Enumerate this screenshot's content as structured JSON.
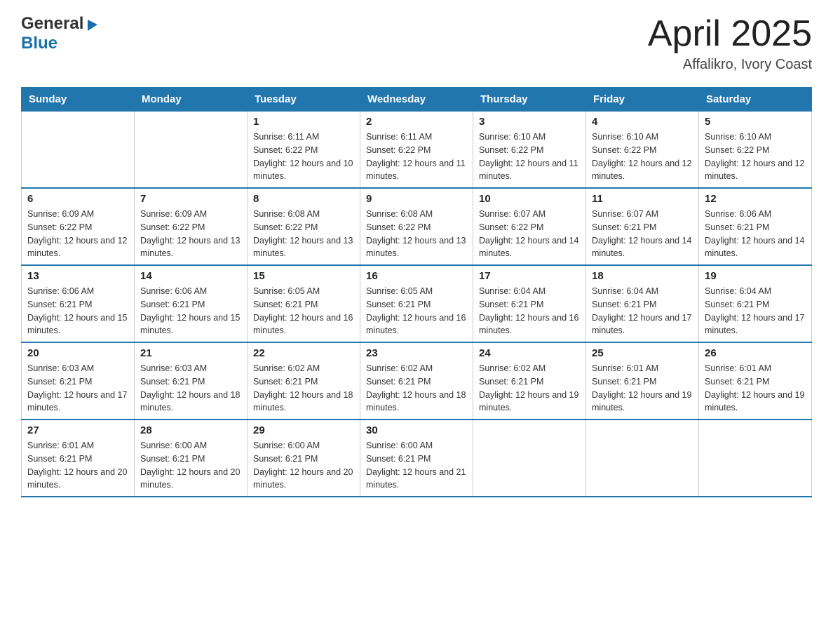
{
  "header": {
    "logo": {
      "general": "General",
      "blue": "Blue",
      "triangle": "▶"
    },
    "title": "April 2025",
    "location": "Affalikro, Ivory Coast"
  },
  "calendar": {
    "days_of_week": [
      "Sunday",
      "Monday",
      "Tuesday",
      "Wednesday",
      "Thursday",
      "Friday",
      "Saturday"
    ],
    "weeks": [
      [
        {
          "day": "",
          "sunrise": "",
          "sunset": "",
          "daylight": ""
        },
        {
          "day": "",
          "sunrise": "",
          "sunset": "",
          "daylight": ""
        },
        {
          "day": "1",
          "sunrise": "Sunrise: 6:11 AM",
          "sunset": "Sunset: 6:22 PM",
          "daylight": "Daylight: 12 hours and 10 minutes."
        },
        {
          "day": "2",
          "sunrise": "Sunrise: 6:11 AM",
          "sunset": "Sunset: 6:22 PM",
          "daylight": "Daylight: 12 hours and 11 minutes."
        },
        {
          "day": "3",
          "sunrise": "Sunrise: 6:10 AM",
          "sunset": "Sunset: 6:22 PM",
          "daylight": "Daylight: 12 hours and 11 minutes."
        },
        {
          "day": "4",
          "sunrise": "Sunrise: 6:10 AM",
          "sunset": "Sunset: 6:22 PM",
          "daylight": "Daylight: 12 hours and 12 minutes."
        },
        {
          "day": "5",
          "sunrise": "Sunrise: 6:10 AM",
          "sunset": "Sunset: 6:22 PM",
          "daylight": "Daylight: 12 hours and 12 minutes."
        }
      ],
      [
        {
          "day": "6",
          "sunrise": "Sunrise: 6:09 AM",
          "sunset": "Sunset: 6:22 PM",
          "daylight": "Daylight: 12 hours and 12 minutes."
        },
        {
          "day": "7",
          "sunrise": "Sunrise: 6:09 AM",
          "sunset": "Sunset: 6:22 PM",
          "daylight": "Daylight: 12 hours and 13 minutes."
        },
        {
          "day": "8",
          "sunrise": "Sunrise: 6:08 AM",
          "sunset": "Sunset: 6:22 PM",
          "daylight": "Daylight: 12 hours and 13 minutes."
        },
        {
          "day": "9",
          "sunrise": "Sunrise: 6:08 AM",
          "sunset": "Sunset: 6:22 PM",
          "daylight": "Daylight: 12 hours and 13 minutes."
        },
        {
          "day": "10",
          "sunrise": "Sunrise: 6:07 AM",
          "sunset": "Sunset: 6:22 PM",
          "daylight": "Daylight: 12 hours and 14 minutes."
        },
        {
          "day": "11",
          "sunrise": "Sunrise: 6:07 AM",
          "sunset": "Sunset: 6:21 PM",
          "daylight": "Daylight: 12 hours and 14 minutes."
        },
        {
          "day": "12",
          "sunrise": "Sunrise: 6:06 AM",
          "sunset": "Sunset: 6:21 PM",
          "daylight": "Daylight: 12 hours and 14 minutes."
        }
      ],
      [
        {
          "day": "13",
          "sunrise": "Sunrise: 6:06 AM",
          "sunset": "Sunset: 6:21 PM",
          "daylight": "Daylight: 12 hours and 15 minutes."
        },
        {
          "day": "14",
          "sunrise": "Sunrise: 6:06 AM",
          "sunset": "Sunset: 6:21 PM",
          "daylight": "Daylight: 12 hours and 15 minutes."
        },
        {
          "day": "15",
          "sunrise": "Sunrise: 6:05 AM",
          "sunset": "Sunset: 6:21 PM",
          "daylight": "Daylight: 12 hours and 16 minutes."
        },
        {
          "day": "16",
          "sunrise": "Sunrise: 6:05 AM",
          "sunset": "Sunset: 6:21 PM",
          "daylight": "Daylight: 12 hours and 16 minutes."
        },
        {
          "day": "17",
          "sunrise": "Sunrise: 6:04 AM",
          "sunset": "Sunset: 6:21 PM",
          "daylight": "Daylight: 12 hours and 16 minutes."
        },
        {
          "day": "18",
          "sunrise": "Sunrise: 6:04 AM",
          "sunset": "Sunset: 6:21 PM",
          "daylight": "Daylight: 12 hours and 17 minutes."
        },
        {
          "day": "19",
          "sunrise": "Sunrise: 6:04 AM",
          "sunset": "Sunset: 6:21 PM",
          "daylight": "Daylight: 12 hours and 17 minutes."
        }
      ],
      [
        {
          "day": "20",
          "sunrise": "Sunrise: 6:03 AM",
          "sunset": "Sunset: 6:21 PM",
          "daylight": "Daylight: 12 hours and 17 minutes."
        },
        {
          "day": "21",
          "sunrise": "Sunrise: 6:03 AM",
          "sunset": "Sunset: 6:21 PM",
          "daylight": "Daylight: 12 hours and 18 minutes."
        },
        {
          "day": "22",
          "sunrise": "Sunrise: 6:02 AM",
          "sunset": "Sunset: 6:21 PM",
          "daylight": "Daylight: 12 hours and 18 minutes."
        },
        {
          "day": "23",
          "sunrise": "Sunrise: 6:02 AM",
          "sunset": "Sunset: 6:21 PM",
          "daylight": "Daylight: 12 hours and 18 minutes."
        },
        {
          "day": "24",
          "sunrise": "Sunrise: 6:02 AM",
          "sunset": "Sunset: 6:21 PM",
          "daylight": "Daylight: 12 hours and 19 minutes."
        },
        {
          "day": "25",
          "sunrise": "Sunrise: 6:01 AM",
          "sunset": "Sunset: 6:21 PM",
          "daylight": "Daylight: 12 hours and 19 minutes."
        },
        {
          "day": "26",
          "sunrise": "Sunrise: 6:01 AM",
          "sunset": "Sunset: 6:21 PM",
          "daylight": "Daylight: 12 hours and 19 minutes."
        }
      ],
      [
        {
          "day": "27",
          "sunrise": "Sunrise: 6:01 AM",
          "sunset": "Sunset: 6:21 PM",
          "daylight": "Daylight: 12 hours and 20 minutes."
        },
        {
          "day": "28",
          "sunrise": "Sunrise: 6:00 AM",
          "sunset": "Sunset: 6:21 PM",
          "daylight": "Daylight: 12 hours and 20 minutes."
        },
        {
          "day": "29",
          "sunrise": "Sunrise: 6:00 AM",
          "sunset": "Sunset: 6:21 PM",
          "daylight": "Daylight: 12 hours and 20 minutes."
        },
        {
          "day": "30",
          "sunrise": "Sunrise: 6:00 AM",
          "sunset": "Sunset: 6:21 PM",
          "daylight": "Daylight: 12 hours and 21 minutes."
        },
        {
          "day": "",
          "sunrise": "",
          "sunset": "",
          "daylight": ""
        },
        {
          "day": "",
          "sunrise": "",
          "sunset": "",
          "daylight": ""
        },
        {
          "day": "",
          "sunrise": "",
          "sunset": "",
          "daylight": ""
        }
      ]
    ]
  }
}
